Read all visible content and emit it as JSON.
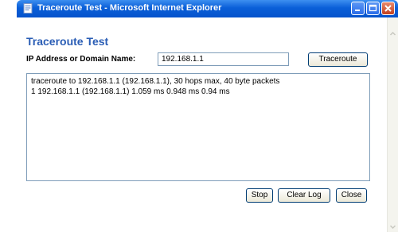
{
  "window": {
    "title": "Traceroute Test - Microsoft Internet Explorer",
    "titlebar_color": "#0a5fd8"
  },
  "page": {
    "title": "Traceroute Test",
    "title_color": "#2a5db5"
  },
  "form": {
    "ip_label": "IP Address or Domain Name:",
    "ip_value": "192.168.1.1",
    "traceroute_button": "Traceroute"
  },
  "log": {
    "lines": [
      "traceroute to 192.168.1.1 (192.168.1.1), 30 hops max, 40 byte packets",
      "1 192.168.1.1 (192.168.1.1) 1.059 ms 0.948 ms 0.94 ms"
    ]
  },
  "actions": {
    "stop": "Stop",
    "clear_log": "Clear Log",
    "close": "Close"
  },
  "icons": {
    "app": "ie-page-icon",
    "minimize": "minimize-icon",
    "maximize": "maximize-icon",
    "close": "close-icon"
  }
}
